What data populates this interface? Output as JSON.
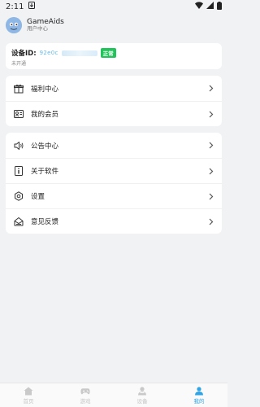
{
  "status_bar": {
    "time": "2:11"
  },
  "profile": {
    "name": "GameAids",
    "subtitle": "用户中心"
  },
  "device": {
    "label": "设备ID:",
    "id_visible": "92e0c",
    "status": "正常",
    "subtitle": "未开通"
  },
  "group1": [
    {
      "icon": "gift-icon",
      "label": "福利中心"
    },
    {
      "icon": "member-card-icon",
      "label": "我的会员"
    }
  ],
  "group2": [
    {
      "icon": "speaker-icon",
      "label": "公告中心"
    },
    {
      "icon": "info-icon",
      "label": "关于软件"
    },
    {
      "icon": "gear-icon",
      "label": "设置"
    },
    {
      "icon": "feedback-icon",
      "label": "意见反馈"
    }
  ],
  "nav": [
    {
      "icon": "home-icon",
      "label": "首页"
    },
    {
      "icon": "gamepad-icon",
      "label": "游戏"
    },
    {
      "icon": "device-icon",
      "label": "设备"
    },
    {
      "icon": "person-icon",
      "label": "我的",
      "active": true
    }
  ],
  "colors": {
    "accent": "#2fa4e7",
    "badge": "#21c45b",
    "background": "#f1f2f4"
  }
}
